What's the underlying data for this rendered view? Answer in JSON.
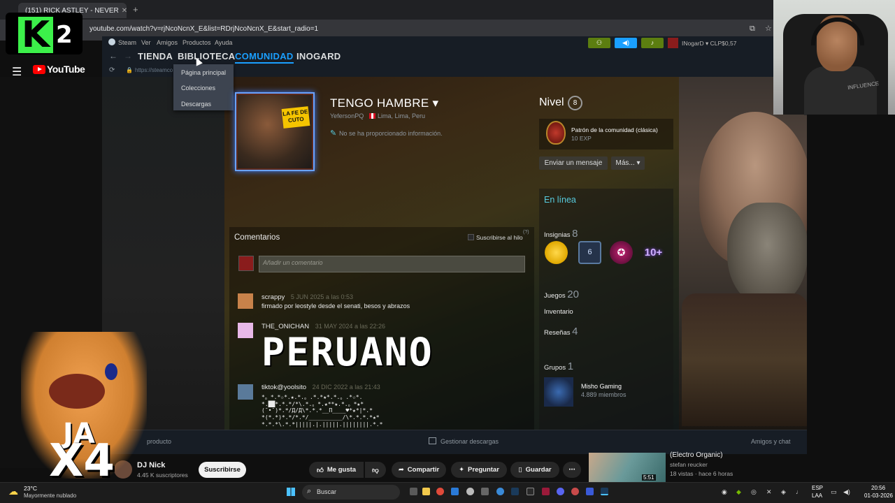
{
  "browser": {
    "tab_title": "(151) RICK ASTLEY - NEVER",
    "url": "youtube.com/watch?v=rjNcoNcnX_E&list=RDrjNcoNcnX_E&start_radio=1"
  },
  "overlay": {
    "k2_letter": "K",
    "k2_number": "2",
    "ja": "JA",
    "x4": "X4"
  },
  "youtube": {
    "logo": "YouTube",
    "channel_name": "DJ Nick",
    "channel_subs": "4.45 K suscriptores",
    "subscribe": "Suscribirse",
    "like": "Me gusta",
    "share": "Compartir",
    "ask": "Preguntar",
    "save": "Guardar",
    "rec_title": "(Electro Organic)",
    "rec_channel": "stefan reucker",
    "rec_views": "18 vistas · hace 6 horas",
    "rec_duration": "5:51"
  },
  "steam": {
    "menu": [
      "Steam",
      "Ver",
      "Amigos",
      "Productos",
      "Ayuda"
    ],
    "nav": {
      "store": "TIENDA",
      "library": "BIBLIOTECA",
      "community": "COMUNIDAD",
      "user": "INOGARD"
    },
    "url": "https://steamco",
    "user_display": "INogarD ▾ CLP$0,57",
    "library_dropdown": [
      "Página principal",
      "Colecciones",
      "Descargas"
    ],
    "profile": {
      "name": "TENGO HAMBRE ▾",
      "avatar_badge": "LA FE DE CUTO",
      "username": "YefersonPQ",
      "location": "Lima, Lima, Peru",
      "info": "No se ha proporcionado información.",
      "level_label": "Nivel",
      "level": "8",
      "badge_name": "Patrón de la comunidad (clásica)",
      "badge_exp": "10 EXP",
      "send_message": "Enviar un mensaje",
      "more": "Más... ▾",
      "status": "En línea",
      "badges_label": "Insignias",
      "badges_count": "8",
      "badge_6": "6",
      "badge_10": "10+",
      "games_label": "Juegos",
      "games_count": "20",
      "inventory": "Inventario",
      "reviews_label": "Reseñas",
      "reviews_count": "4",
      "groups_label": "Grupos",
      "groups_count": "1",
      "group_name": "Misho Gaming",
      "group_members": "4.889 miembros"
    },
    "comments": {
      "title": "Comentarios",
      "subscribe": "Suscribirse al hilo",
      "help": "(?)",
      "placeholder": "Añadir un comentario",
      "items": [
        {
          "author": "scrappy",
          "date": "5 JUN 2025 a las 0:53",
          "text": "firmado por leostyle desde el senati, besos y abrazos"
        },
        {
          "author": "THE_ONICHAN",
          "date": "31 MAY 2024 a las 22:26",
          "text": "PERUANO"
        },
        {
          "author": "tiktok@yoolsito",
          "date": "24 DIC 2022 a las 21:43",
          "text": ""
        }
      ],
      "ascii_lines": [
        "*。*.*☆*.★.*.。.*.*★*.*.。.*☆*.",
        "*.██*.*.*/*\\.*.。*.★**★.*.。*★*",
        "(¯•¯)*.*/Д/Д\\*.*.*__Π____♥*★*|*.*",
        "*(*.*)*.*/*.*/__________/\\*.*.*.*★*",
        "*.*.*\\.*.*|||||.|.|||||.||||||||.*.*"
      ]
    },
    "bottom": {
      "left": "producto",
      "middle": "Gestionar descargas",
      "right": "Amigos y chat"
    }
  },
  "webcam": {
    "shirt_text": "INFLUENCE"
  },
  "taskbar": {
    "weather_temp": "23°C",
    "weather_desc": "Mayormente nublado",
    "search": "Buscar",
    "lang1": "ESP",
    "lang2": "LAA",
    "time": "20:56",
    "date": "01-03-2026"
  },
  "icons": [
    "hamburger-icon",
    "youtube-logo-icon",
    "back-icon",
    "forward-icon",
    "refresh-icon",
    "lock-icon",
    "steam-icon",
    "friends-icon",
    "megaphone-icon",
    "bell-icon",
    "info-icon",
    "thumb-up-icon",
    "thumb-down-icon",
    "share-icon",
    "sparkle-icon",
    "bookmark-icon",
    "more-icon",
    "windows-icon",
    "search-icon",
    "weather-icon"
  ],
  "colors": {
    "steam_bg": "#171d25",
    "steam_blue": "#1a9fff",
    "online": "#57cbde",
    "steam_green": "#5c7e10",
    "yt_red": "#ff0000"
  }
}
